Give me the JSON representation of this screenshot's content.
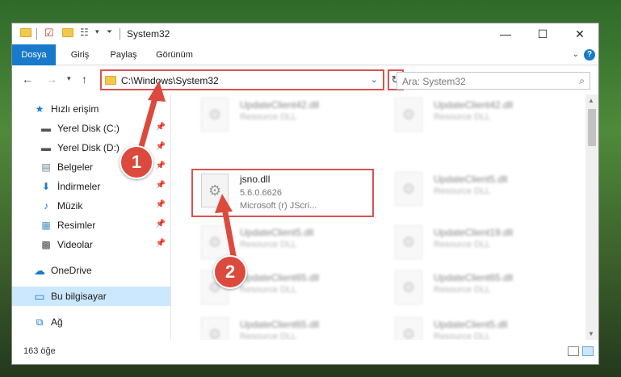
{
  "window": {
    "title": "System32",
    "controls": {
      "minimize": "—",
      "maximize": "☐",
      "close": "✕"
    }
  },
  "ribbon": {
    "tabs": [
      {
        "label": "Dosya"
      },
      {
        "label": "Giriş"
      },
      {
        "label": "Paylaş"
      },
      {
        "label": "Görünüm"
      }
    ],
    "help": "?"
  },
  "address": {
    "path": "C:\\Windows\\System32",
    "search_placeholder": "Ara: System32"
  },
  "nav": {
    "items": [
      {
        "label": "Hızlı erişim",
        "icon": "star-icon",
        "glyph": "★",
        "pinned": false
      },
      {
        "label": "Yerel Disk (C:)",
        "icon": "drive-icon",
        "glyph": "▬",
        "pinned": true
      },
      {
        "label": "Yerel Disk (D:)",
        "icon": "drive-icon",
        "glyph": "▬",
        "pinned": true
      },
      {
        "label": "Belgeler",
        "icon": "document-icon",
        "glyph": "▤",
        "pinned": true
      },
      {
        "label": "İndirmeler",
        "icon": "download-icon",
        "glyph": "⬇",
        "pinned": true
      },
      {
        "label": "Müzik",
        "icon": "music-icon",
        "glyph": "♪",
        "pinned": true
      },
      {
        "label": "Resimler",
        "icon": "pictures-icon",
        "glyph": "▦",
        "pinned": true
      },
      {
        "label": "Videolar",
        "icon": "video-icon",
        "glyph": "▩",
        "pinned": true
      },
      {
        "label": "OneDrive",
        "icon": "cloud-icon",
        "glyph": "☁",
        "pinned": false
      },
      {
        "label": "Bu bilgisayar",
        "icon": "computer-icon",
        "glyph": "▭",
        "pinned": false,
        "selected": true
      },
      {
        "label": "Ağ",
        "icon": "network-icon",
        "glyph": "⧉",
        "pinned": false
      }
    ]
  },
  "files": {
    "left": [
      {
        "name": "UpdateClient42.dll",
        "type": "Resource DLL",
        "blurred": true
      },
      {
        "name": "jsno.dll",
        "version": "5.6.0.6626",
        "desc": "Microsoft (r) JScri...",
        "blurred": false
      },
      {
        "name": "UpdateClient5.dll",
        "type": "Resource DLL",
        "blurred": true
      },
      {
        "name": "UpdateClient65.dll",
        "type": "Resource DLL",
        "blurred": true
      },
      {
        "name": "UpdateClient65.dll",
        "type": "Resource DLL",
        "blurred": true
      }
    ],
    "right": [
      {
        "name": "UpdateClient42.dll",
        "type": "Resource DLL"
      },
      {
        "name": "UpdateClient5.dll",
        "type": "Resource DLL"
      },
      {
        "name": "UpdateClient19.dll",
        "type": "Resource DLL"
      },
      {
        "name": "UpdateClient65.dll",
        "type": "Resource DLL"
      },
      {
        "name": "UpdateClient5.dll",
        "type": "Resource DLL"
      }
    ]
  },
  "status": {
    "count": "163 öğe"
  },
  "annotations": {
    "step1": "1",
    "step2": "2"
  },
  "colors": {
    "accent": "#1979ca",
    "highlight": "#d9534f",
    "badge": "#dc4a3d"
  }
}
